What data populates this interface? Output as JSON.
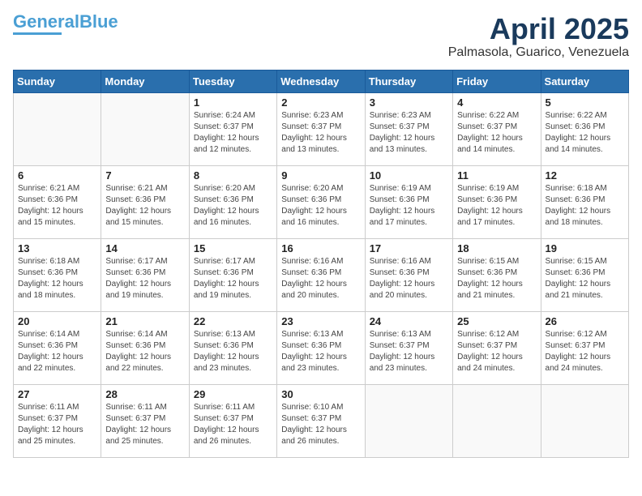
{
  "header": {
    "logo_line1": "General",
    "logo_line2": "Blue",
    "month_title": "April 2025",
    "subtitle": "Palmasola, Guarico, Venezuela"
  },
  "days_of_week": [
    "Sunday",
    "Monday",
    "Tuesday",
    "Wednesday",
    "Thursday",
    "Friday",
    "Saturday"
  ],
  "weeks": [
    [
      {
        "day": "",
        "info": ""
      },
      {
        "day": "",
        "info": ""
      },
      {
        "day": "1",
        "info": "Sunrise: 6:24 AM\nSunset: 6:37 PM\nDaylight: 12 hours\nand 12 minutes."
      },
      {
        "day": "2",
        "info": "Sunrise: 6:23 AM\nSunset: 6:37 PM\nDaylight: 12 hours\nand 13 minutes."
      },
      {
        "day": "3",
        "info": "Sunrise: 6:23 AM\nSunset: 6:37 PM\nDaylight: 12 hours\nand 13 minutes."
      },
      {
        "day": "4",
        "info": "Sunrise: 6:22 AM\nSunset: 6:37 PM\nDaylight: 12 hours\nand 14 minutes."
      },
      {
        "day": "5",
        "info": "Sunrise: 6:22 AM\nSunset: 6:36 PM\nDaylight: 12 hours\nand 14 minutes."
      }
    ],
    [
      {
        "day": "6",
        "info": "Sunrise: 6:21 AM\nSunset: 6:36 PM\nDaylight: 12 hours\nand 15 minutes."
      },
      {
        "day": "7",
        "info": "Sunrise: 6:21 AM\nSunset: 6:36 PM\nDaylight: 12 hours\nand 15 minutes."
      },
      {
        "day": "8",
        "info": "Sunrise: 6:20 AM\nSunset: 6:36 PM\nDaylight: 12 hours\nand 16 minutes."
      },
      {
        "day": "9",
        "info": "Sunrise: 6:20 AM\nSunset: 6:36 PM\nDaylight: 12 hours\nand 16 minutes."
      },
      {
        "day": "10",
        "info": "Sunrise: 6:19 AM\nSunset: 6:36 PM\nDaylight: 12 hours\nand 17 minutes."
      },
      {
        "day": "11",
        "info": "Sunrise: 6:19 AM\nSunset: 6:36 PM\nDaylight: 12 hours\nand 17 minutes."
      },
      {
        "day": "12",
        "info": "Sunrise: 6:18 AM\nSunset: 6:36 PM\nDaylight: 12 hours\nand 18 minutes."
      }
    ],
    [
      {
        "day": "13",
        "info": "Sunrise: 6:18 AM\nSunset: 6:36 PM\nDaylight: 12 hours\nand 18 minutes."
      },
      {
        "day": "14",
        "info": "Sunrise: 6:17 AM\nSunset: 6:36 PM\nDaylight: 12 hours\nand 19 minutes."
      },
      {
        "day": "15",
        "info": "Sunrise: 6:17 AM\nSunset: 6:36 PM\nDaylight: 12 hours\nand 19 minutes."
      },
      {
        "day": "16",
        "info": "Sunrise: 6:16 AM\nSunset: 6:36 PM\nDaylight: 12 hours\nand 20 minutes."
      },
      {
        "day": "17",
        "info": "Sunrise: 6:16 AM\nSunset: 6:36 PM\nDaylight: 12 hours\nand 20 minutes."
      },
      {
        "day": "18",
        "info": "Sunrise: 6:15 AM\nSunset: 6:36 PM\nDaylight: 12 hours\nand 21 minutes."
      },
      {
        "day": "19",
        "info": "Sunrise: 6:15 AM\nSunset: 6:36 PM\nDaylight: 12 hours\nand 21 minutes."
      }
    ],
    [
      {
        "day": "20",
        "info": "Sunrise: 6:14 AM\nSunset: 6:36 PM\nDaylight: 12 hours\nand 22 minutes."
      },
      {
        "day": "21",
        "info": "Sunrise: 6:14 AM\nSunset: 6:36 PM\nDaylight: 12 hours\nand 22 minutes."
      },
      {
        "day": "22",
        "info": "Sunrise: 6:13 AM\nSunset: 6:36 PM\nDaylight: 12 hours\nand 23 minutes."
      },
      {
        "day": "23",
        "info": "Sunrise: 6:13 AM\nSunset: 6:36 PM\nDaylight: 12 hours\nand 23 minutes."
      },
      {
        "day": "24",
        "info": "Sunrise: 6:13 AM\nSunset: 6:37 PM\nDaylight: 12 hours\nand 23 minutes."
      },
      {
        "day": "25",
        "info": "Sunrise: 6:12 AM\nSunset: 6:37 PM\nDaylight: 12 hours\nand 24 minutes."
      },
      {
        "day": "26",
        "info": "Sunrise: 6:12 AM\nSunset: 6:37 PM\nDaylight: 12 hours\nand 24 minutes."
      }
    ],
    [
      {
        "day": "27",
        "info": "Sunrise: 6:11 AM\nSunset: 6:37 PM\nDaylight: 12 hours\nand 25 minutes."
      },
      {
        "day": "28",
        "info": "Sunrise: 6:11 AM\nSunset: 6:37 PM\nDaylight: 12 hours\nand 25 minutes."
      },
      {
        "day": "29",
        "info": "Sunrise: 6:11 AM\nSunset: 6:37 PM\nDaylight: 12 hours\nand 26 minutes."
      },
      {
        "day": "30",
        "info": "Sunrise: 6:10 AM\nSunset: 6:37 PM\nDaylight: 12 hours\nand 26 minutes."
      },
      {
        "day": "",
        "info": ""
      },
      {
        "day": "",
        "info": ""
      },
      {
        "day": "",
        "info": ""
      }
    ]
  ]
}
